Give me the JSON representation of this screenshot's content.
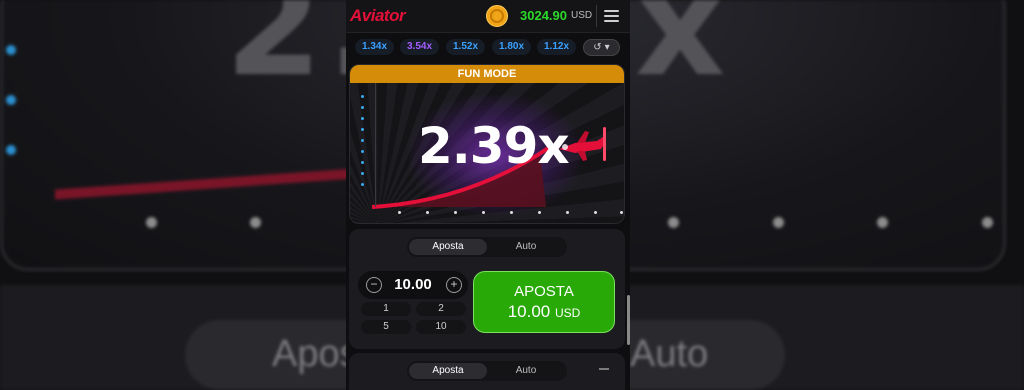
{
  "background": {
    "big_multiplier_left": "2.",
    "big_multiplier_right": "x",
    "tab_left": "Aposta",
    "tab_right": "Auto"
  },
  "header": {
    "logo": "Aviator",
    "balance": "3024.90",
    "currency": "USD",
    "icons": [
      "coin-icon",
      "menu-icon"
    ]
  },
  "history": {
    "multipliers": [
      {
        "value": "1.34x",
        "color": "#3aa0ff"
      },
      {
        "value": "3.54x",
        "color": "#a45cff"
      },
      {
        "value": "1.52x",
        "color": "#3aa0ff"
      },
      {
        "value": "1.80x",
        "color": "#3aa0ff"
      },
      {
        "value": "1.12x",
        "color": "#3aa0ff"
      }
    ],
    "history_icons": [
      "history-icon",
      "chevron-down-icon"
    ]
  },
  "game": {
    "mode_banner": "FUN MODE",
    "multiplier": "2.39x",
    "accent_color": "#e5103a"
  },
  "bet_panel": {
    "tabs": [
      {
        "label": "Aposta",
        "active": true
      },
      {
        "label": "Auto",
        "active": false
      }
    ],
    "stake": "10.00",
    "quick_amounts": [
      "1",
      "2",
      "5",
      "10"
    ],
    "bet_button": {
      "label": "APOSTA",
      "amount": "10.00",
      "currency": "USD"
    }
  },
  "bet_panel_2": {
    "tabs": [
      {
        "label": "Aposta",
        "active": true
      },
      {
        "label": "Auto",
        "active": false
      }
    ]
  }
}
